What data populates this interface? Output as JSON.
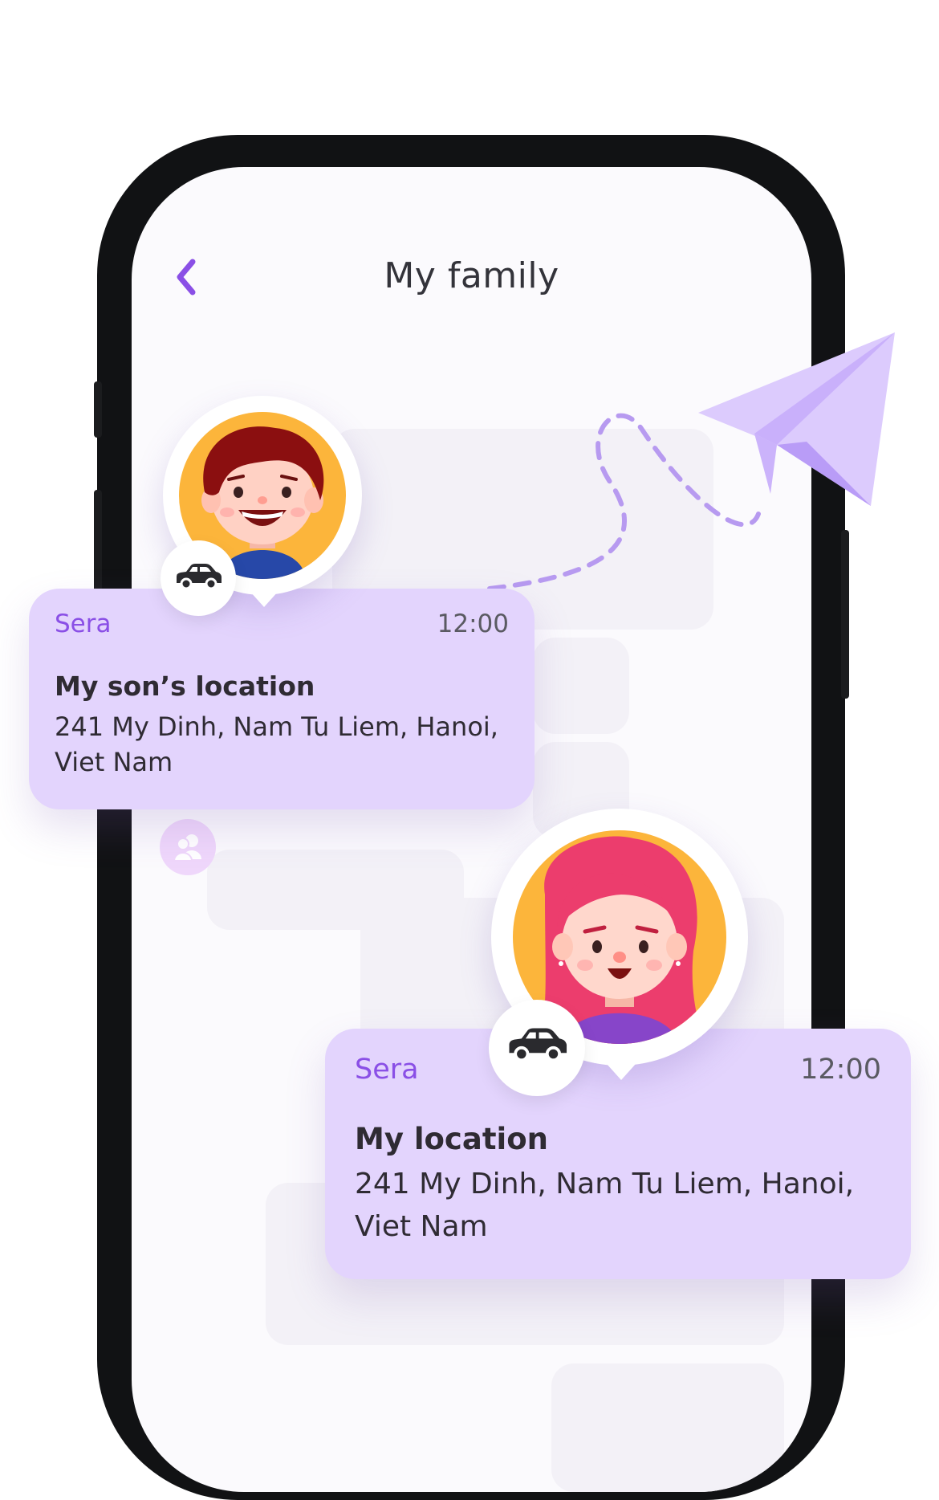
{
  "header": {
    "title": "My family",
    "back_icon": "chevron-left-icon"
  },
  "notifications": [
    {
      "name": "Sera",
      "time": "12:00",
      "title": "My son’s location",
      "address_line1": "241 My Dinh, Nam Tu Liem, Hanoi,",
      "address_line2": "Viet Nam",
      "avatar": "boy-avatar",
      "badge_icon": "car-icon"
    },
    {
      "name": "Sera",
      "time": "12:00",
      "title": "My location",
      "address_line1": "241 My Dinh, Nam Tu Liem, Hanoi,",
      "address_line2": "Viet Nam",
      "avatar": "girl-avatar",
      "badge_icon": "car-icon"
    }
  ],
  "colors": {
    "accent": "#8a4fe6",
    "card_bg": "#e3d4fd",
    "avatar_ring": "#fcb53b",
    "bezel": "#111214"
  }
}
